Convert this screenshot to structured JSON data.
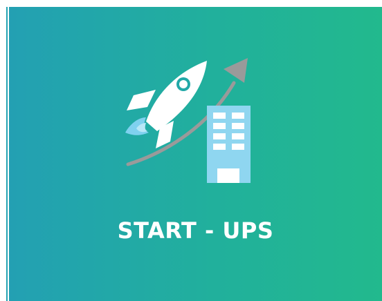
{
  "card": {
    "title": "START - UPS"
  },
  "icons": {
    "rocket": "rocket-icon",
    "growth_arrow": "growth-arrow-icon",
    "building": "building-icon"
  },
  "colors": {
    "gradient_start": "#23a0b3",
    "gradient_end": "#22b98d",
    "rocket": "#ffffff",
    "flame": "#7fd1ef",
    "arrow": "#9a9a9a",
    "building": "#8fd6f0",
    "title": "#ffffff"
  }
}
